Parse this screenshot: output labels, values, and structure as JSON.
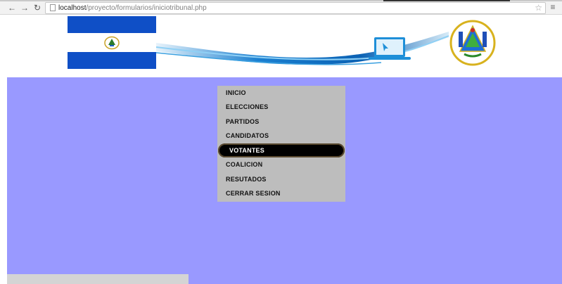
{
  "browser": {
    "back_icon": "back-arrow-icon",
    "forward_icon": "forward-arrow-icon",
    "reload_icon": "reload-icon",
    "url_host": "localhost",
    "url_path": "/proyecto/formularios/iniciotribunal.php",
    "bookmark_icon": "star-icon",
    "menu_icon": "hamburger-menu-icon"
  },
  "header": {
    "left_image": "el-salvador-flag",
    "center_image": "blue-wave-laptop-banner",
    "right_image": "el-salvador-coat-of-arms"
  },
  "colors": {
    "content_bg": "#9999ff",
    "menu_bg": "#bdbdbd",
    "active_item_bg": "#000000",
    "flag_blue": "#0f4fc6"
  },
  "menu": {
    "items": [
      {
        "label": "INICIO"
      },
      {
        "label": "ELECCIONES"
      },
      {
        "label": "PARTIDOS"
      },
      {
        "label": "CANDIDATOS"
      },
      {
        "label": "VOTANTES",
        "active": true
      },
      {
        "label": "COALICION"
      },
      {
        "label": "RESUTADOS"
      },
      {
        "label": "CERRAR SESION"
      }
    ]
  }
}
